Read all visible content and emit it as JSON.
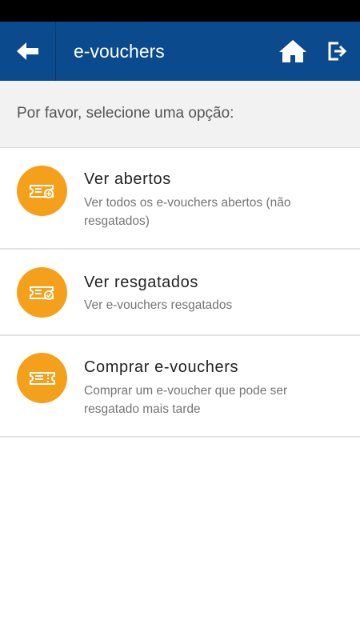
{
  "header": {
    "title": "e-vouchers",
    "back_icon": "arrow-left-icon",
    "home_icon": "home-icon",
    "logout_icon": "logout-icon",
    "background_color": "#0b4a8c"
  },
  "prompt": "Por favor, selecione uma opção:",
  "options": [
    {
      "title": "Ver abertos",
      "description": "Ver todos os e-vouchers abertos (não resgatados)",
      "icon": "ticket-plus-icon"
    },
    {
      "title": "Ver resgatados",
      "description": "Ver e-vouchers resgatados",
      "icon": "ticket-check-icon"
    },
    {
      "title": "Comprar e-vouchers",
      "description": "Comprar um e-voucher que pode ser resgatado mais tarde",
      "icon": "ticket-icon"
    }
  ],
  "accent_color": "#f5a01a"
}
